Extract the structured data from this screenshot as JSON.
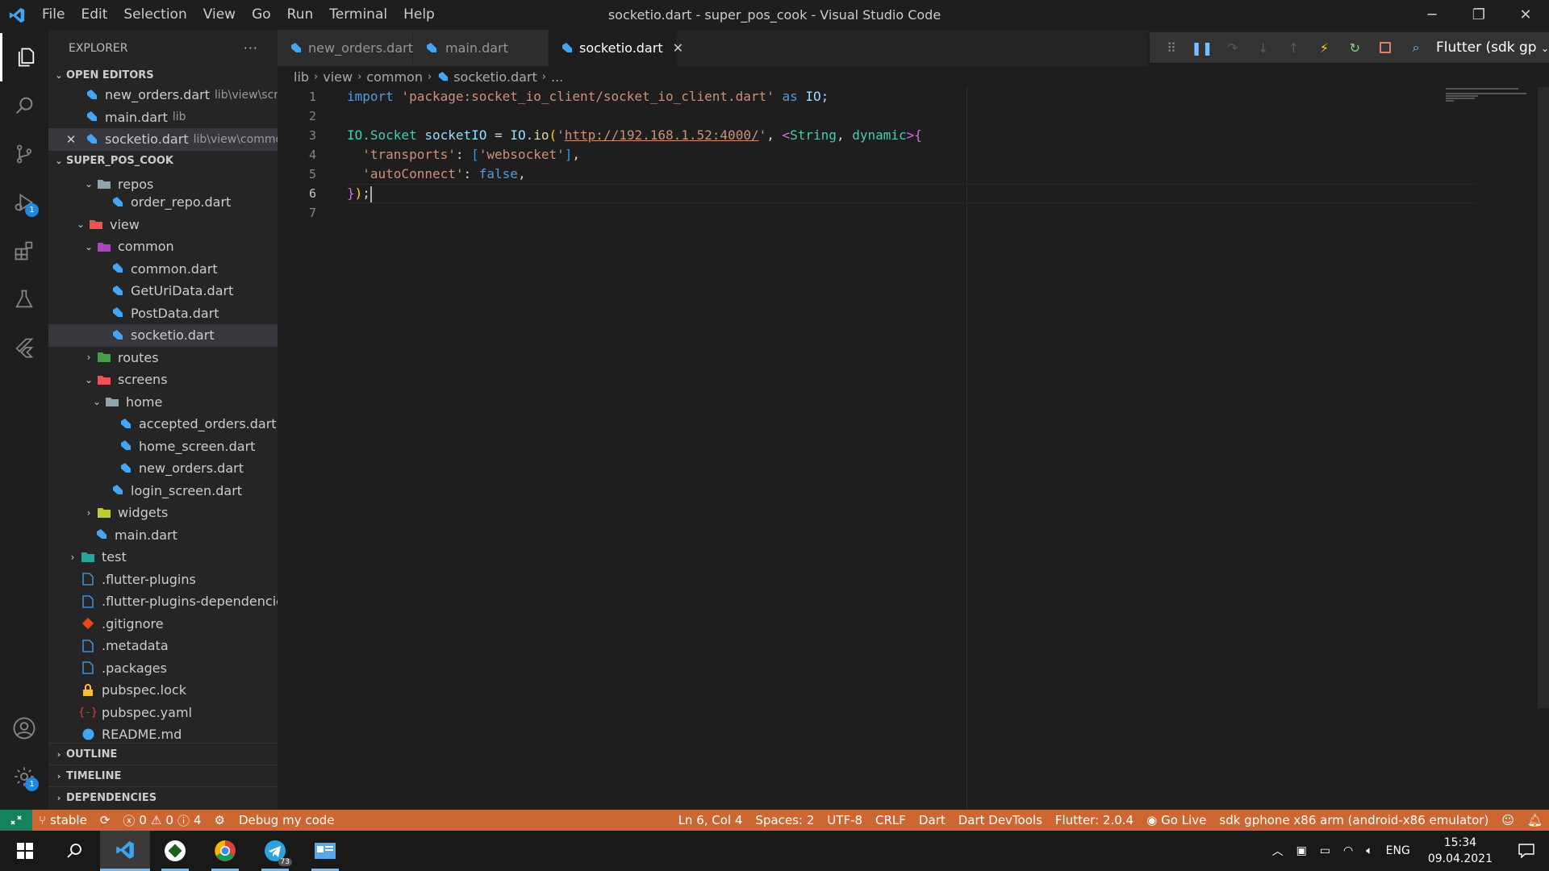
{
  "window": {
    "title": "socketio.dart - super_pos_cook - Visual Studio Code",
    "menu": [
      "File",
      "Edit",
      "Selection",
      "View",
      "Go",
      "Run",
      "Terminal",
      "Help"
    ]
  },
  "activity": {
    "debug_badge": "1",
    "settings_badge": "1"
  },
  "sidebar": {
    "title": "EXPLORER",
    "more": "···",
    "open_editors_label": "OPEN EDITORS",
    "open_editors": [
      {
        "name": "new_orders.dart",
        "path": "lib\\view\\scr..."
      },
      {
        "name": "main.dart",
        "path": "lib"
      },
      {
        "name": "socketio.dart",
        "path": "lib\\view\\common"
      }
    ],
    "project_label": "SUPER_POS_COOK",
    "tree": [
      {
        "name": "repos",
        "type": "folder-open"
      },
      {
        "name": "order_repo.dart",
        "type": "dart"
      },
      {
        "name": "view",
        "type": "folder-open"
      },
      {
        "name": "common",
        "type": "folder-open"
      },
      {
        "name": "common.dart",
        "type": "dart"
      },
      {
        "name": "GetUriData.dart",
        "type": "dart"
      },
      {
        "name": "PostData.dart",
        "type": "dart"
      },
      {
        "name": "socketio.dart",
        "type": "dart"
      },
      {
        "name": "routes",
        "type": "folder"
      },
      {
        "name": "screens",
        "type": "folder-open"
      },
      {
        "name": "home",
        "type": "folder-open"
      },
      {
        "name": "accepted_orders.dart",
        "type": "dart"
      },
      {
        "name": "home_screen.dart",
        "type": "dart"
      },
      {
        "name": "new_orders.dart",
        "type": "dart"
      },
      {
        "name": "login_screen.dart",
        "type": "dart"
      },
      {
        "name": "widgets",
        "type": "folder"
      },
      {
        "name": "main.dart",
        "type": "dart"
      },
      {
        "name": "test",
        "type": "folder"
      },
      {
        "name": ".flutter-plugins",
        "type": "file"
      },
      {
        "name": ".flutter-plugins-dependencies",
        "type": "file"
      },
      {
        "name": ".gitignore",
        "type": "git"
      },
      {
        "name": ".metadata",
        "type": "file"
      },
      {
        "name": ".packages",
        "type": "file"
      },
      {
        "name": "pubspec.lock",
        "type": "lock"
      },
      {
        "name": "pubspec.yaml",
        "type": "yaml"
      },
      {
        "name": "README.md",
        "type": "info"
      }
    ],
    "outline_label": "OUTLINE",
    "timeline_label": "TIMELINE",
    "dependencies_label": "DEPENDENCIES"
  },
  "tabs": [
    {
      "name": "new_orders.dart"
    },
    {
      "name": "main.dart"
    },
    {
      "name": "socketio.dart"
    }
  ],
  "debug": {
    "config": "Flutter (sdk gp"
  },
  "breadcrumb": [
    "lib",
    "view",
    "common",
    "socketio.dart",
    "..."
  ],
  "editor": {
    "line_numbers": [
      "1",
      "2",
      "3",
      "4",
      "5",
      "6",
      "7"
    ],
    "import_kw": "import",
    "import_str": "'package:socket_io_client/socket_io_client.dart'",
    "as_kw": "as",
    "import_alias": "IO;",
    "l3_type": "IO.Socket",
    "l3_var": "socketIO",
    "l3_eq": " = ",
    "l3_ns": "IO.",
    "l3_fn": "io",
    "l3_q1": "'",
    "l3_url": "http://192.168.1.52:4000/",
    "l3_q2": "'",
    "l3_generic_type": "String",
    "l3_generic_kw": "dynamic",
    "l4_key": "'transports'",
    "l4_val": "'websocket'",
    "l5_key": "'autoConnect'",
    "l5_val": "false"
  },
  "status": {
    "branch": "stable",
    "errors": "0",
    "warnings": "0",
    "infos": "4",
    "debug_label": "Debug my code",
    "position": "Ln 6, Col 4",
    "spaces": "Spaces: 2",
    "encoding": "UTF-8",
    "eol": "CRLF",
    "language": "Dart",
    "devtools": "Dart DevTools",
    "flutter": "Flutter: 2.0.4",
    "golive": "Go Live",
    "device": "sdk gphone x86 arm (android-x86 emulator)"
  },
  "taskbar": {
    "telegram_badge": "73",
    "lang": "ENG",
    "time": "15:34",
    "date": "09.04.2021"
  },
  "colors": {
    "statusbar": "#cc6633",
    "accent": "#007acc",
    "dart_icon": "#42a5f5"
  }
}
